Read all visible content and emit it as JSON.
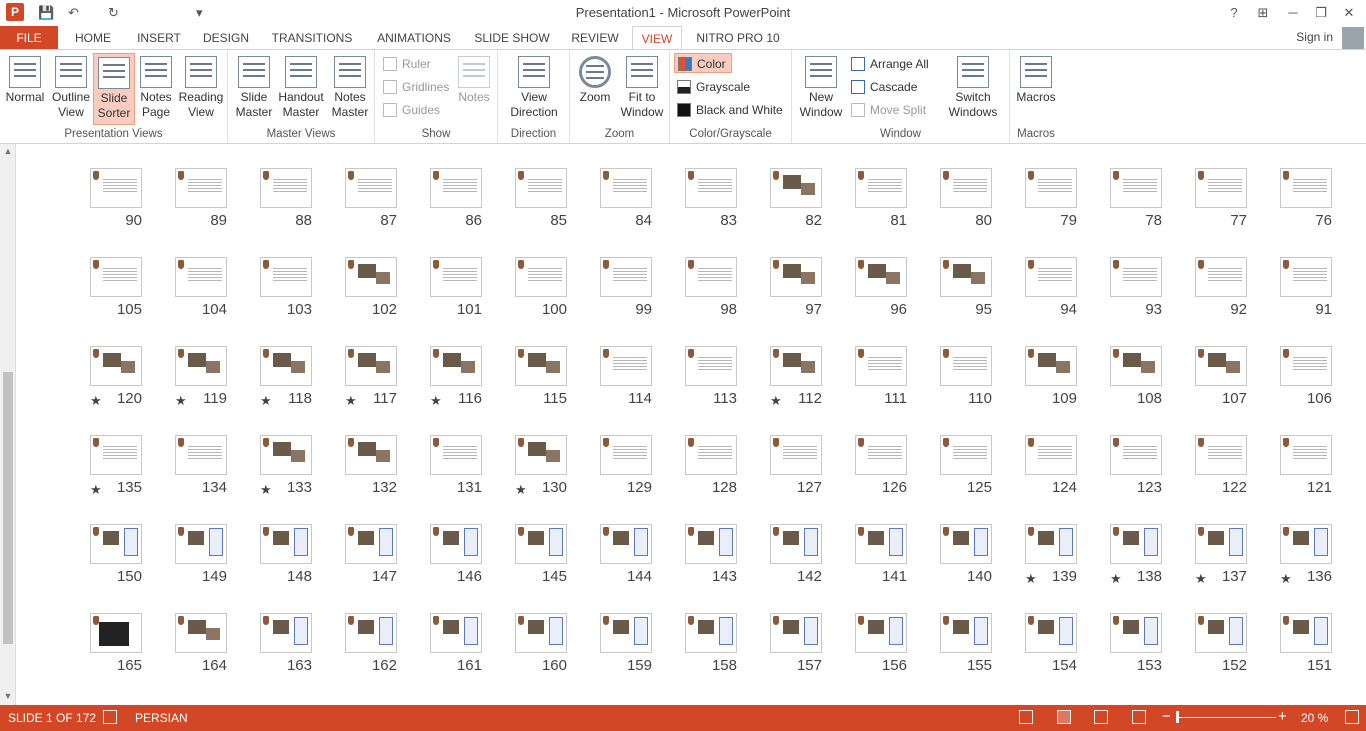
{
  "window": {
    "title": "Presentation1 - Microsoft PowerPoint",
    "help": "?",
    "minimize": "─",
    "restore": "❐",
    "close": "✕",
    "ribbon_opts": "⊞"
  },
  "qat": {
    "app_icon": "P",
    "save": "💾",
    "undo": "↶",
    "redo": "↻",
    "customize": "▾"
  },
  "tabs": [
    {
      "label": "FILE"
    },
    {
      "label": "HOME"
    },
    {
      "label": "INSERT"
    },
    {
      "label": "DESIGN"
    },
    {
      "label": "TRANSITIONS"
    },
    {
      "label": "ANIMATIONS"
    },
    {
      "label": "SLIDE SHOW"
    },
    {
      "label": "REVIEW"
    },
    {
      "label": "VIEW"
    },
    {
      "label": "NITRO PRO 10"
    }
  ],
  "account": {
    "sign_in": "Sign in"
  },
  "ribbon": {
    "presentation_views": {
      "label": "Presentation Views",
      "normal": "Normal",
      "outline": "Outline View",
      "slide_sorter": "Slide Sorter",
      "notes_page": "Notes Page",
      "reading": "Reading View"
    },
    "master_views": {
      "label": "Master Views",
      "slide": "Slide Master",
      "handout": "Handout Master",
      "notes": "Notes Master"
    },
    "show": {
      "label": "Show",
      "ruler": "Ruler",
      "gridlines": "Gridlines",
      "guides": "Guides",
      "notes": "Notes"
    },
    "direction": {
      "label": "Direction",
      "view_direction": "View Direction"
    },
    "zoom": {
      "label": "Zoom",
      "zoom": "Zoom",
      "fit": "Fit to Window"
    },
    "color": {
      "label": "Color/Grayscale",
      "color": "Color",
      "grayscale": "Grayscale",
      "bw": "Black and White"
    },
    "window": {
      "label": "Window",
      "new_window": "New Window",
      "arrange": "Arrange All",
      "cascade": "Cascade",
      "move_split": "Move Split",
      "switch": "Switch Windows"
    },
    "macros": {
      "label": "Macros",
      "macros": "Macros"
    }
  },
  "slides": {
    "rows": [
      [
        {
          "n": "90"
        },
        {
          "n": "89"
        },
        {
          "n": "88"
        },
        {
          "n": "87"
        },
        {
          "n": "86"
        },
        {
          "n": "85"
        },
        {
          "n": "84"
        },
        {
          "n": "83"
        },
        {
          "n": "82",
          "k": "pic"
        },
        {
          "n": "81"
        },
        {
          "n": "80"
        },
        {
          "n": "79"
        },
        {
          "n": "78"
        },
        {
          "n": "77"
        },
        {
          "n": "76"
        }
      ],
      [
        {
          "n": "105"
        },
        {
          "n": "104"
        },
        {
          "n": "103"
        },
        {
          "n": "102",
          "k": "pic"
        },
        {
          "n": "101"
        },
        {
          "n": "100"
        },
        {
          "n": "99"
        },
        {
          "n": "98"
        },
        {
          "n": "97",
          "k": "pic"
        },
        {
          "n": "96",
          "k": "pic"
        },
        {
          "n": "95",
          "k": "pic"
        },
        {
          "n": "94"
        },
        {
          "n": "93"
        },
        {
          "n": "92"
        },
        {
          "n": "91"
        }
      ],
      [
        {
          "n": "120",
          "s": "★",
          "k": "pic"
        },
        {
          "n": "119",
          "s": "★",
          "k": "pic"
        },
        {
          "n": "118",
          "s": "★",
          "k": "pic"
        },
        {
          "n": "117",
          "s": "★",
          "k": "pic"
        },
        {
          "n": "116",
          "s": "★",
          "k": "pic"
        },
        {
          "n": "115",
          "k": "pic"
        },
        {
          "n": "114"
        },
        {
          "n": "113"
        },
        {
          "n": "112",
          "s": "★",
          "k": "pic"
        },
        {
          "n": "111"
        },
        {
          "n": "110"
        },
        {
          "n": "109",
          "k": "pic"
        },
        {
          "n": "108",
          "k": "pic"
        },
        {
          "n": "107",
          "k": "pic"
        },
        {
          "n": "106"
        }
      ],
      [
        {
          "n": "135",
          "s": "★"
        },
        {
          "n": "134"
        },
        {
          "n": "133",
          "s": "★",
          "k": "pic"
        },
        {
          "n": "132",
          "k": "pic"
        },
        {
          "n": "131"
        },
        {
          "n": "130",
          "s": "★",
          "k": "pic"
        },
        {
          "n": "129"
        },
        {
          "n": "128"
        },
        {
          "n": "127"
        },
        {
          "n": "126"
        },
        {
          "n": "125"
        },
        {
          "n": "124"
        },
        {
          "n": "123"
        },
        {
          "n": "122"
        },
        {
          "n": "121"
        }
      ],
      [
        {
          "n": "150",
          "k": "dg"
        },
        {
          "n": "149",
          "k": "dg"
        },
        {
          "n": "148",
          "k": "dg"
        },
        {
          "n": "147",
          "k": "dg"
        },
        {
          "n": "146",
          "k": "dg"
        },
        {
          "n": "145",
          "k": "dg"
        },
        {
          "n": "144",
          "k": "dg"
        },
        {
          "n": "143",
          "k": "dg"
        },
        {
          "n": "142",
          "k": "dg"
        },
        {
          "n": "141",
          "k": "dg"
        },
        {
          "n": "140",
          "k": "dg"
        },
        {
          "n": "139",
          "s": "★",
          "k": "dg"
        },
        {
          "n": "138",
          "s": "★",
          "k": "dg"
        },
        {
          "n": "137",
          "s": "★",
          "k": "dg"
        },
        {
          "n": "136",
          "s": "★",
          "k": "dg"
        }
      ],
      [
        {
          "n": "165",
          "k": "dk"
        },
        {
          "n": "164",
          "k": "pic"
        },
        {
          "n": "163",
          "k": "dg"
        },
        {
          "n": "162",
          "k": "dg"
        },
        {
          "n": "161",
          "k": "dg"
        },
        {
          "n": "160",
          "k": "dg"
        },
        {
          "n": "159",
          "k": "dg"
        },
        {
          "n": "158",
          "k": "dg"
        },
        {
          "n": "157",
          "k": "dg"
        },
        {
          "n": "156",
          "k": "dg"
        },
        {
          "n": "155",
          "k": "dg"
        },
        {
          "n": "154",
          "k": "dg"
        },
        {
          "n": "153",
          "k": "dg"
        },
        {
          "n": "152",
          "k": "dg"
        },
        {
          "n": "151",
          "k": "dg"
        }
      ]
    ]
  },
  "status": {
    "slide": "SLIDE 1 OF 172",
    "language": "PERSIAN",
    "zoom": "20 %",
    "minus": "−",
    "plus": "+"
  },
  "colors": {
    "accent": "#d24726"
  }
}
